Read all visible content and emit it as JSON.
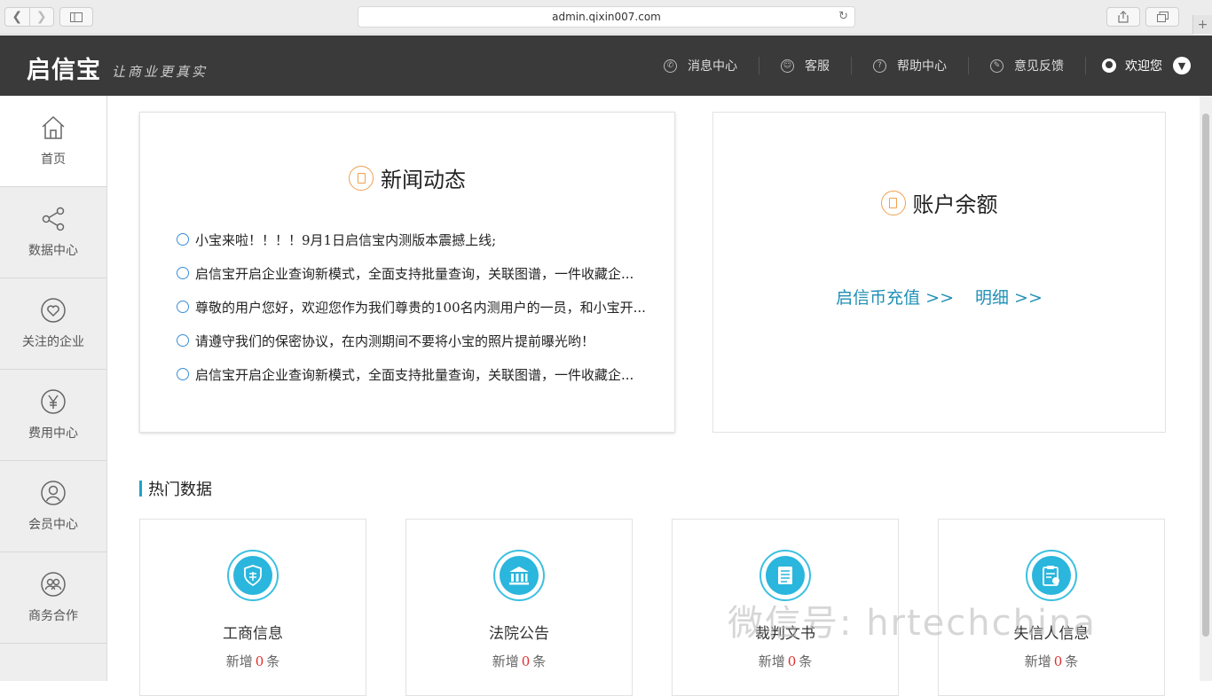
{
  "browser": {
    "url": "admin.qixin007.com"
  },
  "header": {
    "logo_text": "启信宝",
    "slogan": "让商业更真实",
    "nav": [
      {
        "label": "消息中心",
        "icon": "message-icon"
      },
      {
        "label": "客服",
        "icon": "smile-icon"
      },
      {
        "label": "帮助中心",
        "icon": "help-icon"
      },
      {
        "label": "意见反馈",
        "icon": "feedback-icon"
      }
    ],
    "welcome": "欢迎您"
  },
  "sidebar": {
    "items": [
      {
        "label": "首页",
        "icon": "home-icon",
        "active": true
      },
      {
        "label": "数据中心",
        "icon": "share-icon"
      },
      {
        "label": "关注的企业",
        "icon": "heart-icon"
      },
      {
        "label": "费用中心",
        "icon": "yen-icon"
      },
      {
        "label": "会员中心",
        "icon": "user-icon"
      },
      {
        "label": "商务合作",
        "icon": "partners-icon"
      }
    ]
  },
  "news": {
    "title": "新闻动态",
    "items": [
      "小宝来啦！！！！9月1日启信宝内测版本震撼上线;",
      "启信宝开启企业查询新模式，全面支持批量查询，关联图谱，一件收藏企...",
      "尊敬的用户您好，欢迎您作为我们尊贵的100名内测用户的一员，和小宝开...",
      "请遵守我们的保密协议，在内测期间不要将小宝的照片提前曝光哟！",
      "启信宝开启企业查询新模式，全面支持批量查询，关联图谱，一件收藏企..."
    ]
  },
  "balance": {
    "title": "账户余额",
    "recharge_label": "启信币充值 >>",
    "detail_label": "明细 >>"
  },
  "hot": {
    "title": "热门数据",
    "cards": [
      {
        "name": "工商信息",
        "prefix": "新增",
        "count": "0",
        "suffix": "条",
        "icon": "shield-icon"
      },
      {
        "name": "法院公告",
        "prefix": "新增",
        "count": "0",
        "suffix": "条",
        "icon": "courthouse-icon"
      },
      {
        "name": "裁判文书",
        "prefix": "新增",
        "count": "0",
        "suffix": "条",
        "icon": "document-icon"
      },
      {
        "name": "失信人信息",
        "prefix": "新增",
        "count": "0",
        "suffix": "条",
        "icon": "clipboard-icon"
      }
    ]
  },
  "watermark": "微信号: hrtechchina",
  "colors": {
    "header_bg": "#3a3a3a",
    "accent": "#1aa4c8",
    "link": "#1f8fb5",
    "count": "#e03030",
    "title_icon": "#f0a050"
  }
}
